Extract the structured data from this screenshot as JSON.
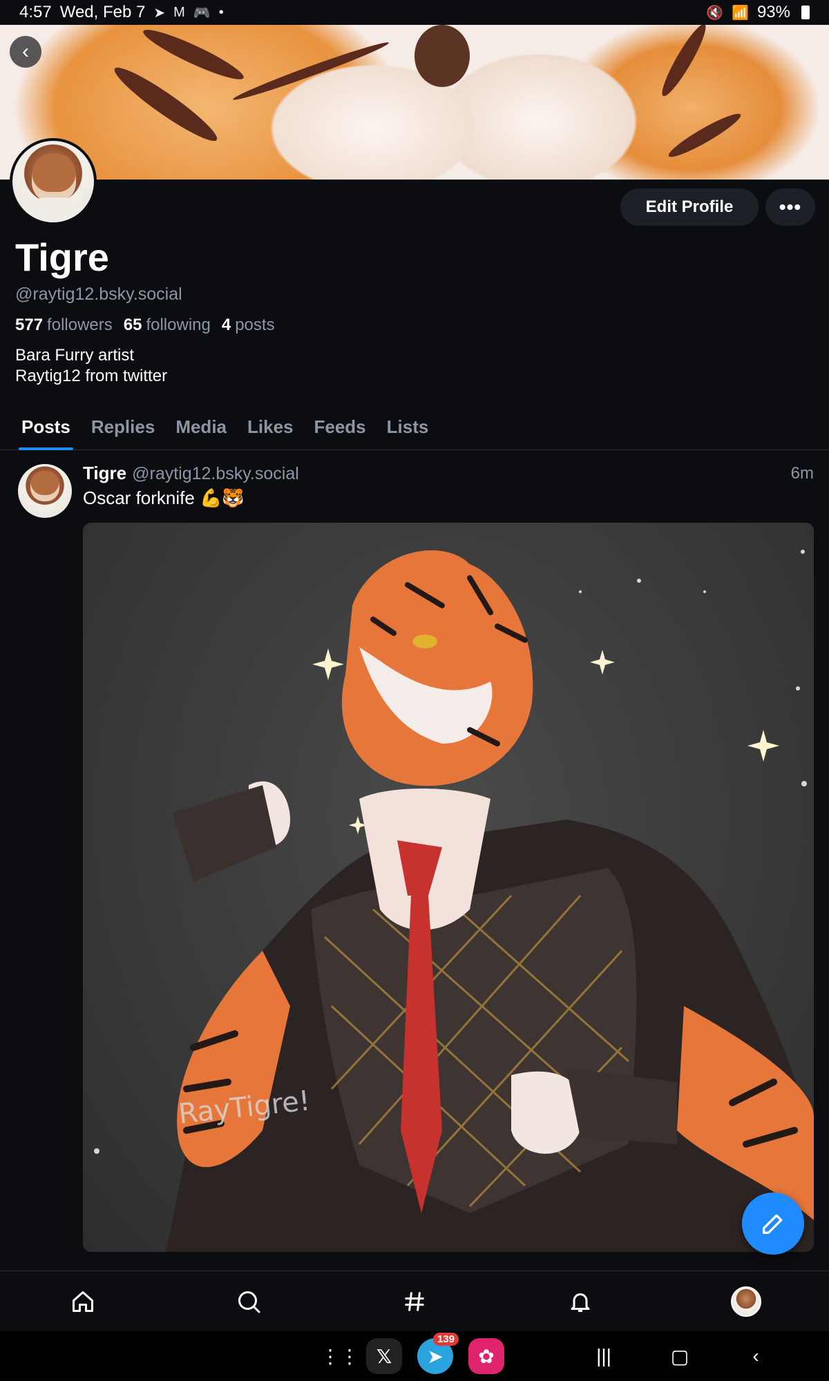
{
  "status_bar": {
    "time": "4:57",
    "date": "Wed, Feb 7",
    "notification_icons": [
      "telegram-icon",
      "gmail-icon",
      "game-controller-icon",
      "dot-icon"
    ],
    "battery": "93%"
  },
  "profile": {
    "display_name": "Tigre",
    "handle": "@raytig12.bsky.social",
    "followers_count": "577",
    "followers_label": "followers",
    "following_count": "65",
    "following_label": "following",
    "posts_count": "4",
    "posts_label": "posts",
    "bio_line1": "Bara Furry artist",
    "bio_line2": "Raytig12 from twitter",
    "edit_profile_label": "Edit Profile",
    "more_label": "•••"
  },
  "tabs": [
    {
      "label": "Posts",
      "active": true
    },
    {
      "label": "Replies",
      "active": false
    },
    {
      "label": "Media",
      "active": false
    },
    {
      "label": "Likes",
      "active": false
    },
    {
      "label": "Feeds",
      "active": false
    },
    {
      "label": "Lists",
      "active": false
    }
  ],
  "post": {
    "author": "Tigre",
    "handle": "@raytig12.bsky.social",
    "time": "6m",
    "text": "Oscar forknife 💪🐯",
    "image_signature": "RayTigre!"
  },
  "bottom_nav": [
    "home-icon",
    "search-icon",
    "hashtag-icon",
    "notifications-icon",
    "profile-avatar"
  ],
  "system_bar": {
    "telegram_badge": "139"
  },
  "colors": {
    "background": "#0b0d10",
    "accent": "#208bfe",
    "muted_text": "#8c97a6",
    "button_bg": "#1c2128"
  }
}
